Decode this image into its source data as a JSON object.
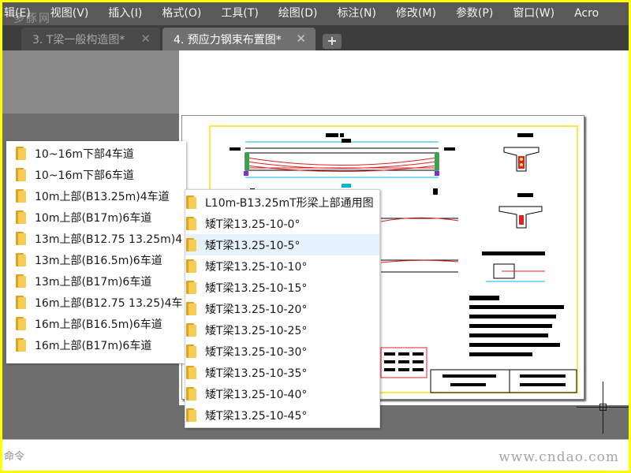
{
  "menu": [
    "辑(E)",
    "视图(V)",
    "插入(I)",
    "格式(O)",
    "工具(T)",
    "绘图(D)",
    "标注(N)",
    "修改(M)",
    "参数(P)",
    "窗口(W)",
    "Acro"
  ],
  "watermark_top": "多豚网",
  "tabs": [
    {
      "label": "3. T梁一般构造图*"
    },
    {
      "label": "4. 预应力钢束布置图*"
    }
  ],
  "icons": {
    "tab_close": "close-icon",
    "new_tab": "plus-icon",
    "folder": "folder-icon"
  },
  "close_glyph": "✕",
  "new_tab_glyph": "+",
  "popup_left": {
    "items": [
      "10~16m下部4车道",
      "10~16m下部6车道",
      "10m上部(B13.25m)4车道",
      "10m上部(B17m)6车道",
      "13m上部(B12.75  13.25m)4",
      "13m上部(B16.5m)6车道",
      "13m上部(B17m)6车道",
      "16m上部(B12.75  13.25)4车",
      "16m上部(B16.5m)6车道",
      "16m上部(B17m)6车道"
    ]
  },
  "popup_right": {
    "selected_index": 2,
    "items": [
      "L10m-B13.25mT形梁上部通用图",
      "矮T梁13.25-10-0°",
      "矮T梁13.25-10-5°",
      "矮T梁13.25-10-10°",
      "矮T梁13.25-10-15°",
      "矮T梁13.25-10-20°",
      "矮T梁13.25-10-25°",
      "矮T梁13.25-10-30°",
      "矮T梁13.25-10-35°",
      "矮T梁13.25-10-40°",
      "矮T梁13.25-10-45°"
    ]
  },
  "command_line": {
    "text": "命令"
  },
  "watermark_url": "www.cndao.com",
  "colors": {
    "frame": "#ffff00",
    "menubar": "#595959",
    "tabbar": "#3d3d3d",
    "active_tab": "#707070",
    "selected_item": "#e5f1fb",
    "drawing_red": "#e02020",
    "drawing_cyan": "#00b7d9",
    "drawing_border": "#ffe94a"
  }
}
